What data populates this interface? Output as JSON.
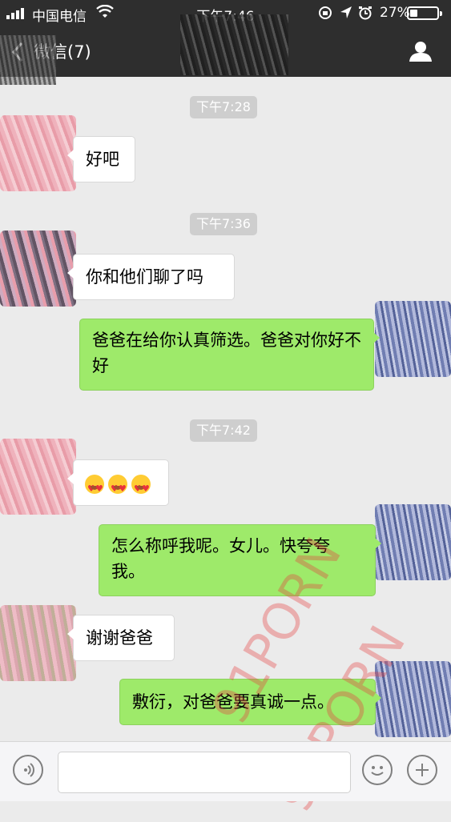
{
  "status_bar": {
    "carrier": "中国电信",
    "time": "下午7:46",
    "battery_percent": "27%",
    "battery_level": 0.27
  },
  "nav": {
    "back_label": "微信(7)"
  },
  "messages": [
    {
      "type": "timestamp",
      "text": "下午7:28"
    },
    {
      "type": "incoming",
      "text": "好吧"
    },
    {
      "type": "timestamp",
      "text": "下午7:36"
    },
    {
      "type": "incoming",
      "text": "你和他们聊了吗"
    },
    {
      "type": "outgoing",
      "text": "爸爸在给你认真筛选。爸爸对你好不好"
    },
    {
      "type": "timestamp",
      "text": "下午7:42"
    },
    {
      "type": "incoming",
      "emoji": [
        "heart-eyes-emoji",
        "heart-eyes-emoji",
        "heart-eyes-emoji"
      ]
    },
    {
      "type": "outgoing",
      "text": "怎么称呼我呢。女儿。快夸夸我。"
    },
    {
      "type": "incoming",
      "text": "谢谢爸爸"
    },
    {
      "type": "outgoing",
      "text": "敷衍，对爸爸要真诚一点。"
    }
  ],
  "watermark": {
    "text": "91PORN",
    "color": "#e63c3c"
  },
  "icons": {
    "voice": "voice-icon",
    "emoji": "emoji-icon",
    "more": "plus-icon",
    "profile": "person-icon"
  }
}
